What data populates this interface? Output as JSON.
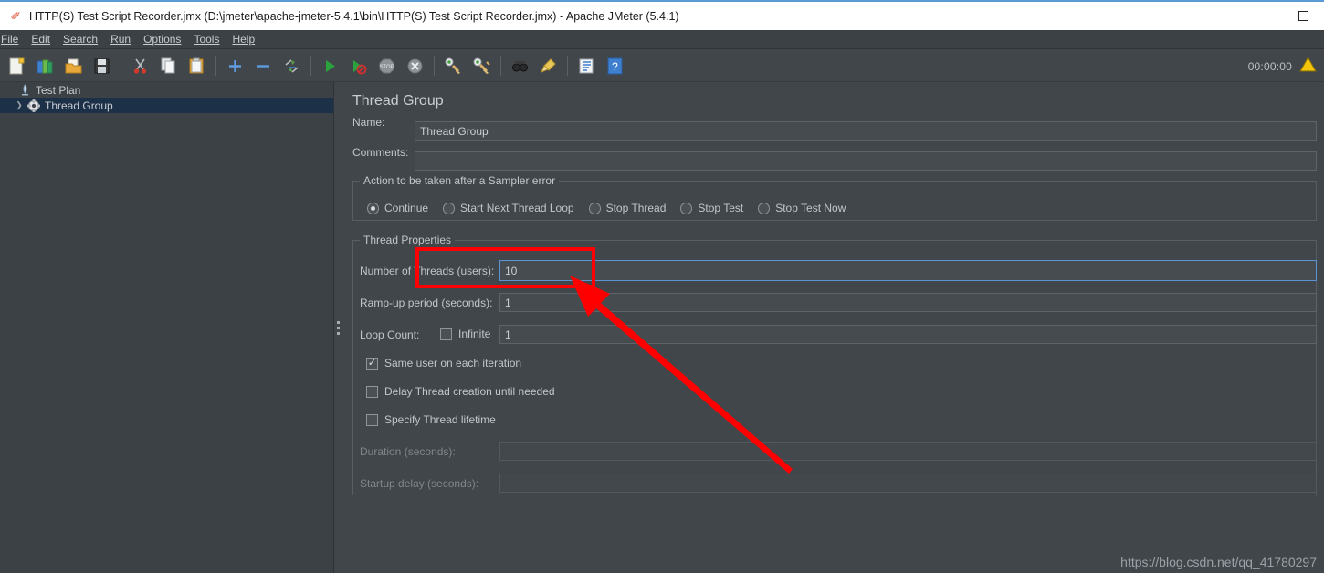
{
  "window": {
    "title": "HTTP(S) Test Script Recorder.jmx (D:\\jmeter\\apache-jmeter-5.4.1\\bin\\HTTP(S) Test Script Recorder.jmx) - Apache JMeter (5.4.1)",
    "app_icon": "jmeter-feather-icon",
    "minimize_label": "—",
    "maximize_label": "□"
  },
  "menubar": {
    "items": [
      {
        "label": "File",
        "mnemonic": "F"
      },
      {
        "label": "Edit",
        "mnemonic": "E"
      },
      {
        "label": "Search",
        "mnemonic": "S"
      },
      {
        "label": "Run",
        "mnemonic": "R"
      },
      {
        "label": "Options",
        "mnemonic": "O"
      },
      {
        "label": "Tools",
        "mnemonic": "T"
      },
      {
        "label": "Help",
        "mnemonic": "H"
      }
    ]
  },
  "toolbar": {
    "buttons": [
      {
        "name": "new-icon",
        "tooltip": "New"
      },
      {
        "name": "templates-icon",
        "tooltip": "Templates"
      },
      {
        "name": "open-icon",
        "tooltip": "Open"
      },
      {
        "name": "save-icon",
        "tooltip": "Save Test Plan"
      },
      {
        "name": "cut-icon",
        "tooltip": "Cut"
      },
      {
        "name": "copy-icon",
        "tooltip": "Copy"
      },
      {
        "name": "paste-icon",
        "tooltip": "Paste"
      },
      {
        "name": "expand-all-icon",
        "tooltip": "Expand All"
      },
      {
        "name": "collapse-all-icon",
        "tooltip": "Collapse All"
      },
      {
        "name": "toggle-icon",
        "tooltip": "Toggle"
      },
      {
        "name": "start-icon",
        "tooltip": "Start"
      },
      {
        "name": "start-no-timers-icon",
        "tooltip": "Start no pauses"
      },
      {
        "name": "stop-icon",
        "tooltip": "Stop"
      },
      {
        "name": "shutdown-icon",
        "tooltip": "Shutdown"
      },
      {
        "name": "clear-icon",
        "tooltip": "Clear"
      },
      {
        "name": "clear-all-icon",
        "tooltip": "Clear All"
      },
      {
        "name": "search-icon",
        "tooltip": "Search"
      },
      {
        "name": "reset-search-icon",
        "tooltip": "Reset Search"
      },
      {
        "name": "function-helper-icon",
        "tooltip": "Function Helper Dialog"
      },
      {
        "name": "help-icon",
        "tooltip": "Help"
      }
    ],
    "timer": "00:00:00",
    "warning_icon": "warning-triangle-icon"
  },
  "tree": {
    "items": [
      {
        "label": "Test Plan",
        "icon": "test-plan-icon",
        "toggle": "",
        "selected": false,
        "indent": 0
      },
      {
        "label": "Thread Group",
        "icon": "thread-group-gear-icon",
        "toggle": "❯",
        "selected": true,
        "indent": 1
      }
    ]
  },
  "panel": {
    "title": "Thread Group",
    "name_label": "Name:",
    "name_value": "Thread Group",
    "comments_label": "Comments:",
    "comments_value": ""
  },
  "sampler_error": {
    "group_title": "Action to be taken after a Sampler error",
    "options": [
      {
        "label": "Continue",
        "selected": true
      },
      {
        "label": "Start Next Thread Loop",
        "selected": false
      },
      {
        "label": "Stop Thread",
        "selected": false
      },
      {
        "label": "Stop Test",
        "selected": false
      },
      {
        "label": "Stop Test Now",
        "selected": false
      }
    ]
  },
  "thread_properties": {
    "group_title": "Thread Properties",
    "num_threads_label": "Number of Threads (users):",
    "num_threads_value": "10",
    "rampup_label": "Ramp-up period (seconds):",
    "rampup_value": "1",
    "loop_count_label": "Loop Count:",
    "infinite_label": "Infinite",
    "infinite_checked": false,
    "loop_count_value": "1",
    "checkboxes": [
      {
        "label": "Same user on each iteration",
        "checked": true
      },
      {
        "label": "Delay Thread creation until needed",
        "checked": false
      },
      {
        "label": "Specify Thread lifetime",
        "checked": false
      }
    ],
    "duration_label": "Duration (seconds):",
    "duration_value": "",
    "startup_delay_label": "Startup delay (seconds):",
    "startup_delay_value": ""
  },
  "annotation": {
    "highlight_color": "#fe0000",
    "target": "number-of-threads-field"
  },
  "watermark": "https://blog.csdn.net/qq_41780297",
  "colors": {
    "background": "#41464b",
    "panel": "#3c4145",
    "selection": "#1c3048",
    "focus_border": "#5a93cf",
    "text": "#c1c6cb",
    "annotation": "#fe0000"
  }
}
